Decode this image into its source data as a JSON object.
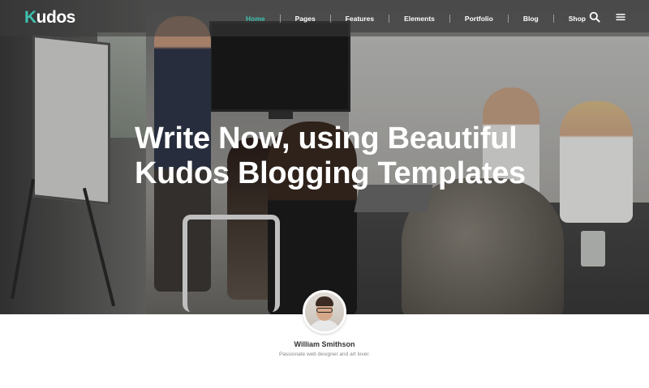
{
  "brand": {
    "logo_first": "K",
    "logo_rest": "udos",
    "accent_color": "#3fc1b0"
  },
  "nav": {
    "items": [
      {
        "label": "Home",
        "active": true
      },
      {
        "label": "Pages",
        "active": false
      },
      {
        "label": "Features",
        "active": false
      },
      {
        "label": "Elements",
        "active": false
      },
      {
        "label": "Portfolio",
        "active": false
      },
      {
        "label": "Blog",
        "active": false
      },
      {
        "label": "Shop",
        "active": false
      }
    ],
    "icons": [
      "search-icon",
      "menu-icon"
    ]
  },
  "hero": {
    "headline_line1": "Write Now, using Beautiful",
    "headline_line2": "Kudos Blogging Templates"
  },
  "author": {
    "name": "William Smithson",
    "bio": "Passionate web designer and art lover."
  }
}
